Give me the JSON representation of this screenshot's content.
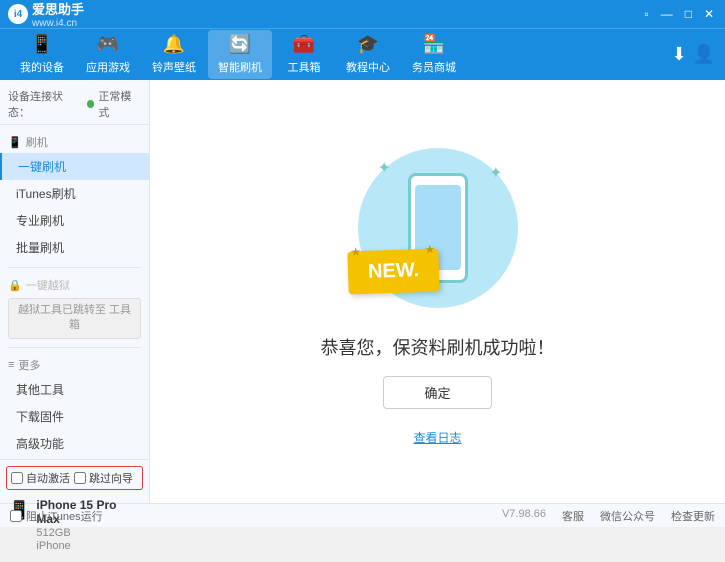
{
  "app": {
    "logo_text": "爱思助手",
    "logo_sub": "www.i4.cn",
    "logo_char": "i4"
  },
  "nav": {
    "items": [
      {
        "id": "my-device",
        "icon": "📱",
        "label": "我的设备"
      },
      {
        "id": "apps",
        "icon": "🎮",
        "label": "应用游戏"
      },
      {
        "id": "ringtone",
        "icon": "🔔",
        "label": "铃声壁纸"
      },
      {
        "id": "smart-flash",
        "icon": "🔄",
        "label": "智能刷机"
      },
      {
        "id": "toolbox",
        "icon": "🧰",
        "label": "工具箱"
      },
      {
        "id": "tutorial",
        "icon": "🎓",
        "label": "教程中心"
      },
      {
        "id": "service",
        "icon": "🏪",
        "label": "务员商城"
      }
    ],
    "download_btn": "⬇",
    "account_btn": "👤"
  },
  "topbar": {
    "win_btns": [
      "▫",
      "—",
      "□",
      "✕"
    ]
  },
  "sidebar": {
    "status_label": "设备连接状态：",
    "status_mode": "正常模式",
    "sections": [
      {
        "header": "刷机",
        "icon": "📱",
        "items": [
          {
            "id": "one-key-flash",
            "label": "一键刷机",
            "active": true
          },
          {
            "id": "itunes-flash",
            "label": "iTunes刷机"
          },
          {
            "id": "pro-flash",
            "label": "专业刷机"
          },
          {
            "id": "batch-flash",
            "label": "批量刷机"
          }
        ]
      },
      {
        "header": "一键越狱",
        "icon": "🔓",
        "disabled": true,
        "notice": "越狱工具已跳转至\n工具箱"
      },
      {
        "header": "更多",
        "icon": "≡",
        "items": [
          {
            "id": "other-tools",
            "label": "其他工具"
          },
          {
            "id": "download-firmware",
            "label": "下载固件"
          },
          {
            "id": "advanced",
            "label": "高级功能"
          }
        ]
      }
    ],
    "auto_activate": "自动激活",
    "guided_activate": "跳过向导",
    "device": {
      "name": "iPhone 15 Pro Max",
      "storage": "512GB",
      "type": "iPhone"
    }
  },
  "content": {
    "success_title": "恭喜您，保资料刷机成功啦！",
    "confirm_label": "确定",
    "log_label": "查看日志"
  },
  "footer": {
    "itunes_label": "阻止iTunes运行",
    "version": "V7.98.66",
    "links": [
      "客服",
      "微信公众号",
      "检查更新"
    ]
  }
}
